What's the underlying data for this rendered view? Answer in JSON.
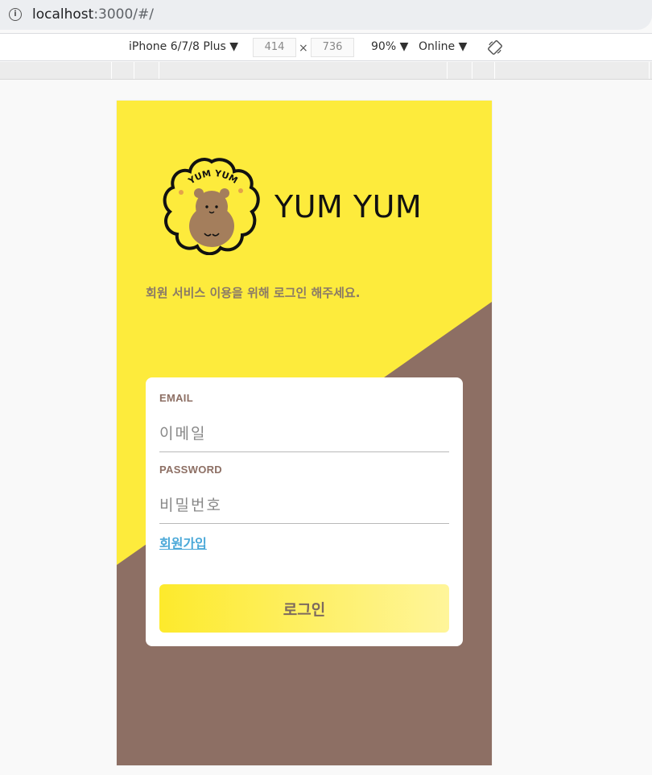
{
  "browser": {
    "url_host": "localhost",
    "url_path": ":3000/#/"
  },
  "devtools": {
    "device": "iPhone 6/7/8 Plus ▼",
    "width": "414",
    "times": "×",
    "height": "736",
    "zoom": "90% ▼",
    "network": "Online ▼"
  },
  "app": {
    "logo_text": "YUM YUM",
    "brand_name": "YUM YUM",
    "subtitle": "회원 서비스 이용을 위해 로그인 해주세요.",
    "colors": {
      "yellow": "#fdeb3c",
      "brown": "#8d6f64",
      "link": "#4aa8d8"
    }
  },
  "login": {
    "email_label": "EMAIL",
    "email_placeholder": "이메일",
    "password_label": "PASSWORD",
    "password_placeholder": "비밀번호",
    "signup_link": "회원가입",
    "login_button": "로그인"
  }
}
